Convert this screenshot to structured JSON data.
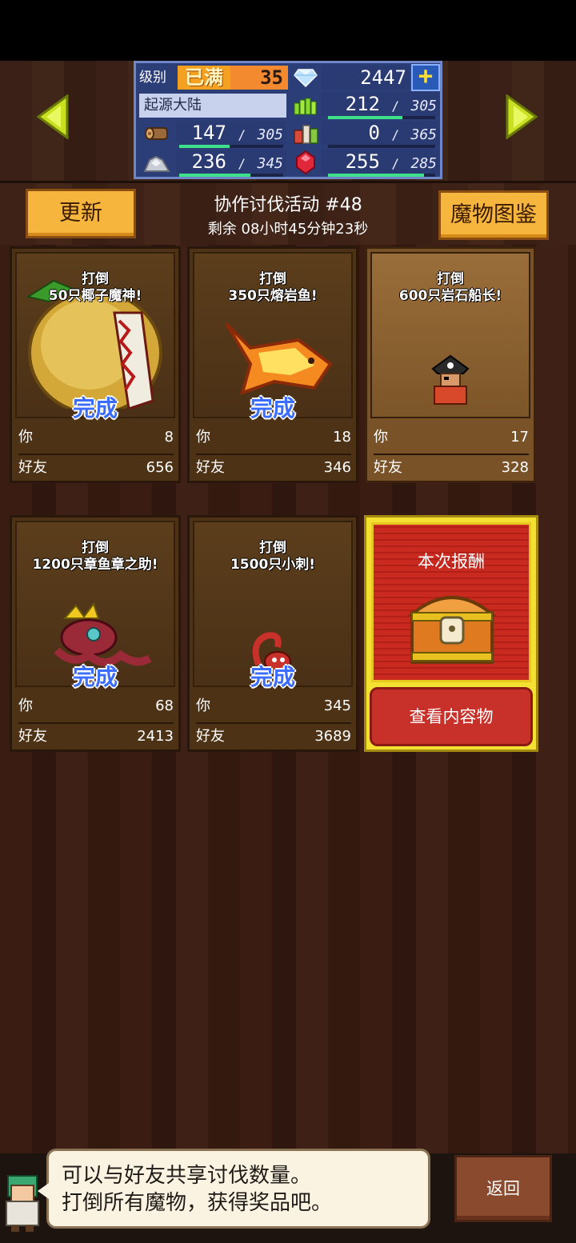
{
  "stats": {
    "level_label": "级别",
    "level_status": "已满",
    "level_value": "35",
    "gems": "2447",
    "plus_label": "+",
    "region": "起源大陆",
    "grass_value": "212",
    "grass_max": "305",
    "wood_value": "147",
    "wood_max": "305",
    "food_value": "0",
    "food_max": "365",
    "ore_value": "236",
    "ore_max": "345",
    "ruby_value": "255",
    "ruby_max": "285",
    "separator": "/"
  },
  "bars": {
    "grass": 0.695,
    "wood": 0.482,
    "food": 0.0,
    "ore": 0.684,
    "ruby": 0.895
  },
  "header": {
    "update_label": "更新",
    "codex_label": "魔物图鉴",
    "event_title": "协作讨伐活动 #48",
    "event_timer": "剩余 08小时45分钟23秒"
  },
  "cards": [
    {
      "goal_line1": "打倒",
      "goal_line2": "50只椰子魔神!",
      "status": "完成",
      "you_label": "你",
      "you": "8",
      "friends_label": "好友",
      "friends": "656"
    },
    {
      "goal_line1": "打倒",
      "goal_line2": "350只熔岩鱼!",
      "status": "完成",
      "you_label": "你",
      "you": "18",
      "friends_label": "好友",
      "friends": "346"
    },
    {
      "goal_line1": "打倒",
      "goal_line2": "600只岩石船长!",
      "status": "",
      "you_label": "你",
      "you": "17",
      "friends_label": "好友",
      "friends": "328"
    },
    {
      "goal_line1": "打倒",
      "goal_line2": "1200只章鱼章之助!",
      "status": "完成",
      "you_label": "你",
      "you": "68",
      "friends_label": "好友",
      "friends": "2413"
    },
    {
      "goal_line1": "打倒",
      "goal_line2": "1500只小刺!",
      "status": "完成",
      "you_label": "你",
      "you": "345",
      "friends_label": "好友",
      "friends": "3689"
    }
  ],
  "reward": {
    "title": "本次报酬",
    "view_label": "查看内容物"
  },
  "footer": {
    "tip_line1": "可以与好友共享讨伐数量。",
    "tip_line2": "打倒所有魔物，获得奖品吧。",
    "back_label": "返回"
  },
  "colors": {
    "accent_gold": "#f6b63e",
    "progress_green": "#3ee08a",
    "done_blue": "#3a6cff",
    "reward_red": "#c82a20"
  }
}
